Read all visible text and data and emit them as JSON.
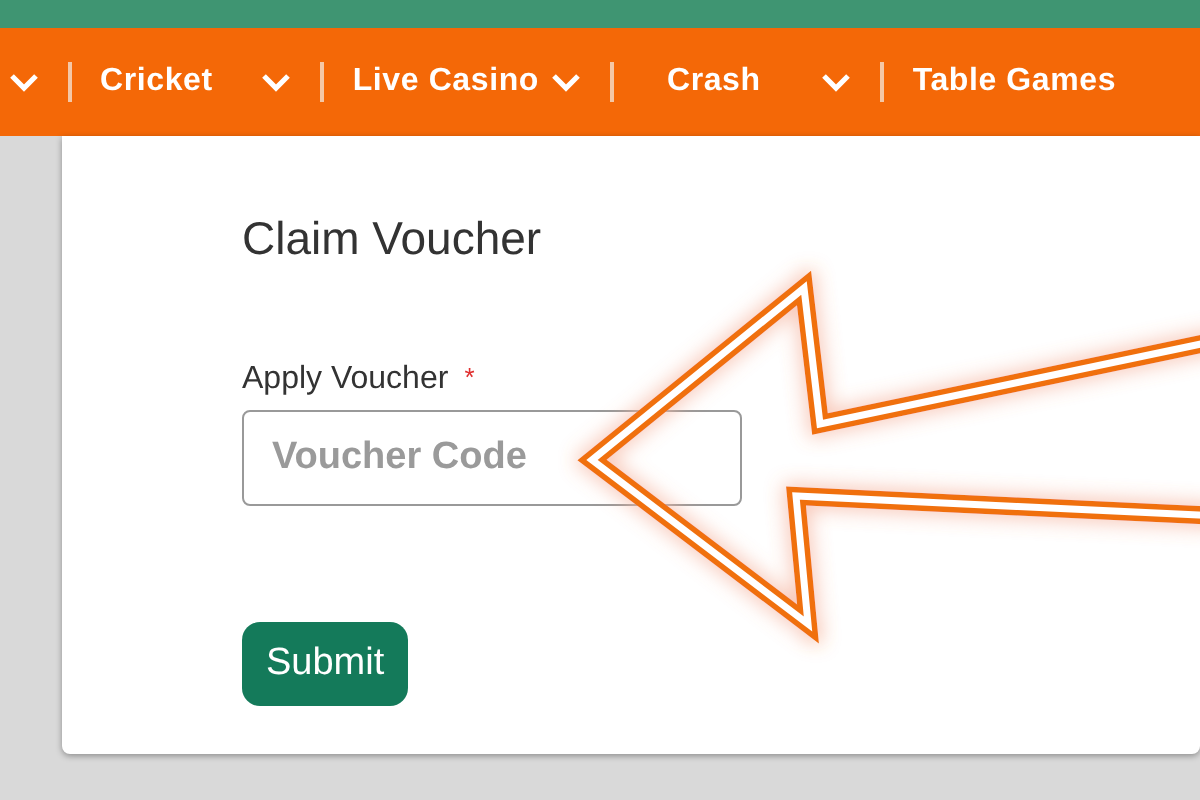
{
  "nav": {
    "items": [
      {
        "kind": "chevron"
      },
      {
        "kind": "menu",
        "label": "Cricket",
        "chevron": true
      },
      {
        "kind": "menu",
        "label": "Live Casino",
        "chevron": true
      },
      {
        "kind": "menu",
        "label": "Crash",
        "chevron": true
      },
      {
        "kind": "menu",
        "label": "Table Games",
        "chevron": false
      }
    ]
  },
  "card": {
    "title": "Claim Voucher",
    "field": {
      "label": "Apply Voucher",
      "required_mark": "*",
      "placeholder": "Voucher Code"
    },
    "submit": "Submit"
  }
}
